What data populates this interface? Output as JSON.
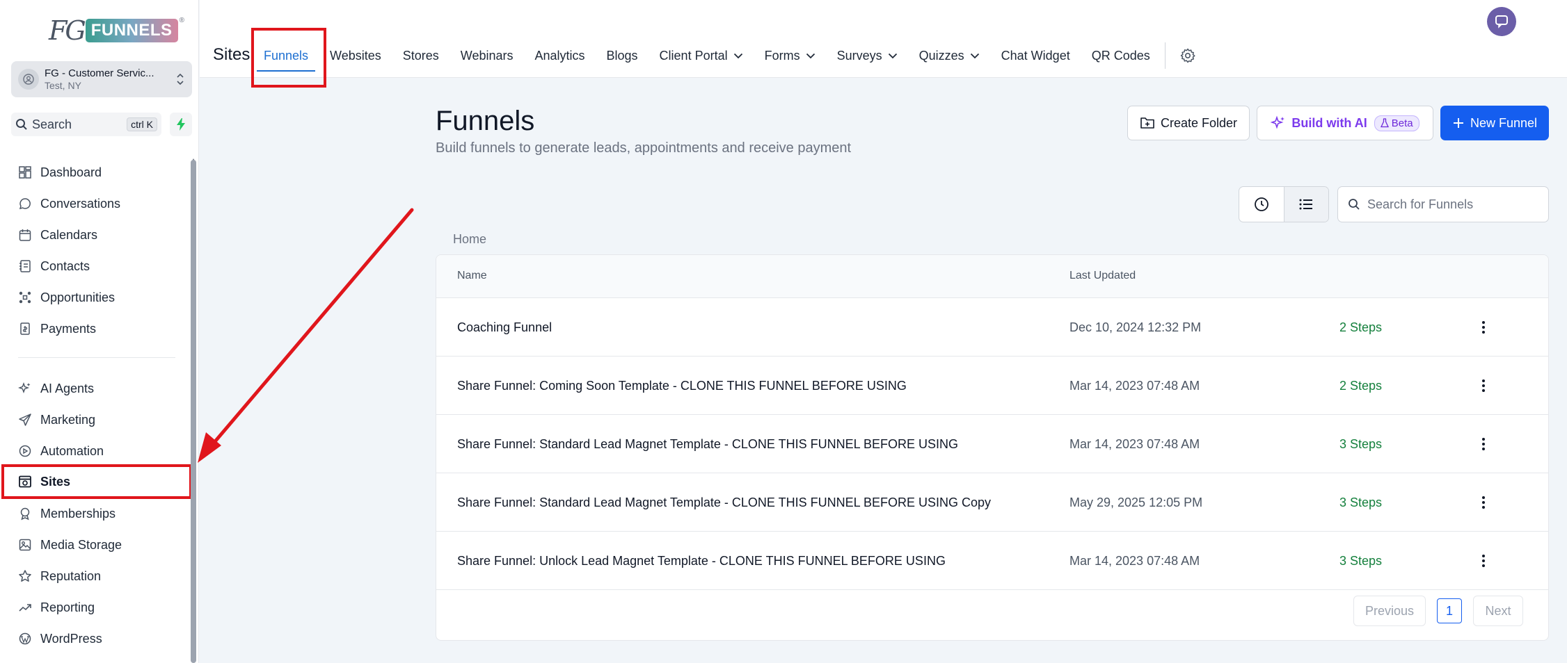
{
  "brand": {
    "logo_prefix": "FG",
    "logo_badge": "FUNNELS",
    "logo_mark": "®"
  },
  "account": {
    "name": "FG - Customer Servic...",
    "location": "Test, NY"
  },
  "sidebar_search": {
    "label": "Search",
    "shortcut": "ctrl K"
  },
  "nav": {
    "items": [
      {
        "label": "Dashboard",
        "icon": "dashboard-icon"
      },
      {
        "label": "Conversations",
        "icon": "chat-bubble-icon"
      },
      {
        "label": "Calendars",
        "icon": "calendar-icon"
      },
      {
        "label": "Contacts",
        "icon": "contacts-icon"
      },
      {
        "label": "Opportunities",
        "icon": "opportunities-icon"
      },
      {
        "label": "Payments",
        "icon": "payments-icon"
      },
      {
        "label": "AI Agents",
        "icon": "sparkle-icon"
      },
      {
        "label": "Marketing",
        "icon": "send-icon"
      },
      {
        "label": "Automation",
        "icon": "automation-icon"
      },
      {
        "label": "Sites",
        "icon": "sites-icon"
      },
      {
        "label": "Memberships",
        "icon": "badge-icon"
      },
      {
        "label": "Media Storage",
        "icon": "image-icon"
      },
      {
        "label": "Reputation",
        "icon": "star-icon"
      },
      {
        "label": "Reporting",
        "icon": "trend-icon"
      },
      {
        "label": "WordPress",
        "icon": "wordpress-icon"
      }
    ]
  },
  "topbar": {
    "title": "Sites",
    "tabs": [
      {
        "label": "Funnels",
        "active": true,
        "dropdown": false
      },
      {
        "label": "Websites",
        "dropdown": false
      },
      {
        "label": "Stores",
        "dropdown": false
      },
      {
        "label": "Webinars",
        "dropdown": false
      },
      {
        "label": "Analytics",
        "dropdown": false
      },
      {
        "label": "Blogs",
        "dropdown": false
      },
      {
        "label": "Client Portal",
        "dropdown": true
      },
      {
        "label": "Forms",
        "dropdown": true
      },
      {
        "label": "Surveys",
        "dropdown": true
      },
      {
        "label": "Quizzes",
        "dropdown": true
      },
      {
        "label": "Chat Widget",
        "dropdown": false
      },
      {
        "label": "QR Codes",
        "dropdown": false
      }
    ]
  },
  "page": {
    "title": "Funnels",
    "subtitle": "Build funnels to generate leads, appointments and receive payment",
    "create_folder": "Create Folder",
    "build_ai": "Build with AI",
    "beta": "Beta",
    "new_funnel": "New Funnel",
    "search_placeholder": "Search for Funnels",
    "breadcrumb": "Home"
  },
  "table": {
    "col_name": "Name",
    "col_updated": "Last Updated",
    "rows": [
      {
        "name": "Coaching Funnel",
        "updated": "Dec 10, 2024 12:32 PM",
        "steps": "2 Steps"
      },
      {
        "name": "Share Funnel: Coming Soon Template - CLONE THIS FUNNEL BEFORE USING",
        "updated": "Mar 14, 2023 07:48 AM",
        "steps": "2 Steps"
      },
      {
        "name": "Share Funnel: Standard Lead Magnet Template - CLONE THIS FUNNEL BEFORE USING",
        "updated": "Mar 14, 2023 07:48 AM",
        "steps": "3 Steps"
      },
      {
        "name": "Share Funnel: Standard Lead Magnet Template - CLONE THIS FUNNEL BEFORE USING Copy",
        "updated": "May 29, 2025 12:05 PM",
        "steps": "3 Steps"
      },
      {
        "name": "Share Funnel: Unlock Lead Magnet Template - CLONE THIS FUNNEL BEFORE USING",
        "updated": "Mar 14, 2023 07:48 AM",
        "steps": "3 Steps"
      }
    ]
  },
  "pagination": {
    "previous": "Previous",
    "current": "1",
    "next": "Next"
  },
  "colors": {
    "accent": "#155eef",
    "annotation": "#e0161c",
    "steps": "#15803d",
    "ai": "#7c3aed"
  }
}
